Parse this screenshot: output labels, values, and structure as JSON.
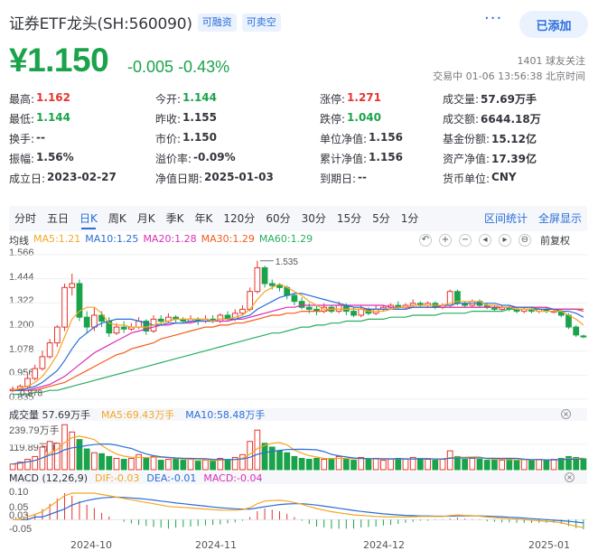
{
  "header": {
    "title": "证券ETF龙头(SH:560090)",
    "tags": [
      "可融资",
      "可卖空"
    ],
    "more_label": "···",
    "add_label": "已添加"
  },
  "quote": {
    "price": "¥1.150",
    "change": "-0.005",
    "change_pct": "-0.43%",
    "followers": "1401 球友关注",
    "trade_time": "交易中 01-06 13:56:38 北京时间",
    "color_up": "#e5352f",
    "color_down": "#1aa34a"
  },
  "stats": [
    [
      {
        "label": "最高:",
        "value": "1.162",
        "tone": "red"
      },
      {
        "label": "今开:",
        "value": "1.144",
        "tone": "green"
      },
      {
        "label": "涨停:",
        "value": "1.271",
        "tone": "red"
      },
      {
        "label": "成交量:",
        "value": "57.69万手",
        "tone": ""
      }
    ],
    [
      {
        "label": "最低:",
        "value": "1.144",
        "tone": "green"
      },
      {
        "label": "昨收:",
        "value": "1.155",
        "tone": ""
      },
      {
        "label": "跌停:",
        "value": "1.040",
        "tone": "green"
      },
      {
        "label": "成交额:",
        "value": "6644.18万",
        "tone": ""
      }
    ],
    [
      {
        "label": "换手:",
        "value": "--",
        "tone": ""
      },
      {
        "label": "市价:",
        "value": "1.150",
        "tone": ""
      },
      {
        "label": "单位净值:",
        "value": "1.156",
        "tone": ""
      },
      {
        "label": "基金份额:",
        "value": "15.12亿",
        "tone": ""
      }
    ],
    [
      {
        "label": "振幅:",
        "value": "1.56%",
        "tone": ""
      },
      {
        "label": "溢价率:",
        "value": "-0.09%",
        "tone": ""
      },
      {
        "label": "累计净值:",
        "value": "1.156",
        "tone": ""
      },
      {
        "label": "资产净值:",
        "value": "17.39亿",
        "tone": ""
      }
    ],
    [
      {
        "label": "成立日:",
        "value": "2023-02-27",
        "tone": ""
      },
      {
        "label": "净值日期:",
        "value": "2025-01-03",
        "tone": ""
      },
      {
        "label": "到期日:",
        "value": "--",
        "tone": ""
      },
      {
        "label": "货币单位:",
        "value": "CNY",
        "tone": ""
      }
    ]
  ],
  "periods": [
    "分时",
    "五日",
    "日K",
    "周K",
    "月K",
    "季K",
    "年K",
    "120分",
    "60分",
    "30分",
    "15分",
    "5分",
    "1分"
  ],
  "active_period": "日K",
  "period_links": [
    "区间统计",
    "全屏显示"
  ],
  "ma_legend": [
    {
      "label": "均线",
      "color": "#33353c"
    },
    {
      "label": "MA5:1.21",
      "color": "#f5a623"
    },
    {
      "label": "MA10:1.25",
      "color": "#2a6dd8"
    },
    {
      "label": "MA20:1.28",
      "color": "#d92fb5"
    },
    {
      "label": "MA30:1.29",
      "color": "#f25c19"
    },
    {
      "label": "MA60:1.29",
      "color": "#27ae60"
    }
  ],
  "tools": [
    "↶",
    "+",
    "−",
    "◂",
    "▸",
    "⊖"
  ],
  "adjust_label": "前复权",
  "price_axis": [
    "1.566",
    "1.444",
    "1.322",
    "1.200",
    "1.078",
    "0.956",
    "0.835"
  ],
  "high_marker": "1.535",
  "low_marker": "0.878",
  "volume": {
    "title": "成交量 57.69万手",
    "ma5": "MA5:69.43万手",
    "ma10": "MA10:58.48万手",
    "axis": [
      "239.79万手",
      "119.89万手"
    ]
  },
  "macd": {
    "title": "MACD (12,26,9)",
    "dif": "DIF:-0.03",
    "dea": "DEA:-0.01",
    "macd": "MACD:-0.04",
    "axis": [
      "0.10",
      "0.05",
      "0.03",
      "-0.05"
    ]
  },
  "x_axis": [
    "2024-10",
    "2024-11",
    "2024-12",
    "2025-01"
  ],
  "chart_data": {
    "type": "candlestick",
    "candles": [
      [
        0.878,
        0.885,
        0.9,
        0.87
      ],
      [
        0.885,
        0.9,
        0.91,
        0.88
      ],
      [
        0.9,
        0.94,
        0.96,
        0.89
      ],
      [
        0.94,
        0.99,
        1.01,
        0.93
      ],
      [
        0.99,
        1.05,
        1.08,
        0.98
      ],
      [
        1.05,
        1.12,
        1.14,
        1.04
      ],
      [
        1.12,
        1.2,
        1.21,
        1.1
      ],
      [
        1.2,
        1.4,
        1.42,
        1.18
      ],
      [
        1.4,
        1.42,
        1.47,
        1.36
      ],
      [
        1.42,
        1.25,
        1.44,
        1.23
      ],
      [
        1.25,
        1.2,
        1.28,
        1.17
      ],
      [
        1.2,
        1.26,
        1.3,
        1.18
      ],
      [
        1.26,
        1.23,
        1.28,
        1.2
      ],
      [
        1.23,
        1.17,
        1.25,
        1.15
      ],
      [
        1.17,
        1.2,
        1.22,
        1.16
      ],
      [
        1.2,
        1.19,
        1.23,
        1.17
      ],
      [
        1.19,
        1.2,
        1.22,
        1.18
      ],
      [
        1.2,
        1.23,
        1.25,
        1.19
      ],
      [
        1.23,
        1.18,
        1.24,
        1.16
      ],
      [
        1.18,
        1.24,
        1.26,
        1.17
      ],
      [
        1.24,
        1.23,
        1.26,
        1.21
      ],
      [
        1.23,
        1.25,
        1.27,
        1.22
      ],
      [
        1.25,
        1.24,
        1.26,
        1.22
      ],
      [
        1.24,
        1.23,
        1.25,
        1.22
      ],
      [
        1.23,
        1.24,
        1.26,
        1.22
      ],
      [
        1.24,
        1.23,
        1.25,
        1.21
      ],
      [
        1.23,
        1.24,
        1.26,
        1.22
      ],
      [
        1.24,
        1.23,
        1.26,
        1.22
      ],
      [
        1.23,
        1.26,
        1.27,
        1.22
      ],
      [
        1.26,
        1.24,
        1.28,
        1.23
      ],
      [
        1.24,
        1.27,
        1.29,
        1.23
      ],
      [
        1.27,
        1.29,
        1.31,
        1.26
      ],
      [
        1.29,
        1.38,
        1.4,
        1.28
      ],
      [
        1.38,
        1.5,
        1.535,
        1.37
      ],
      [
        1.5,
        1.42,
        1.51,
        1.4
      ],
      [
        1.42,
        1.41,
        1.44,
        1.39
      ],
      [
        1.41,
        1.4,
        1.42,
        1.38
      ],
      [
        1.4,
        1.36,
        1.41,
        1.34
      ],
      [
        1.36,
        1.33,
        1.37,
        1.31
      ],
      [
        1.33,
        1.3,
        1.35,
        1.29
      ],
      [
        1.3,
        1.29,
        1.32,
        1.27
      ],
      [
        1.29,
        1.28,
        1.31,
        1.26
      ],
      [
        1.28,
        1.3,
        1.32,
        1.27
      ],
      [
        1.3,
        1.28,
        1.31,
        1.27
      ],
      [
        1.28,
        1.31,
        1.33,
        1.27
      ],
      [
        1.31,
        1.28,
        1.32,
        1.26
      ],
      [
        1.28,
        1.26,
        1.3,
        1.25
      ],
      [
        1.26,
        1.29,
        1.31,
        1.25
      ],
      [
        1.29,
        1.27,
        1.3,
        1.26
      ],
      [
        1.27,
        1.29,
        1.31,
        1.26
      ],
      [
        1.29,
        1.3,
        1.31,
        1.28
      ],
      [
        1.3,
        1.31,
        1.32,
        1.29
      ],
      [
        1.31,
        1.3,
        1.33,
        1.29
      ],
      [
        1.3,
        1.31,
        1.32,
        1.29
      ],
      [
        1.31,
        1.32,
        1.34,
        1.3
      ],
      [
        1.32,
        1.31,
        1.33,
        1.3
      ],
      [
        1.31,
        1.32,
        1.33,
        1.3
      ],
      [
        1.32,
        1.3,
        1.33,
        1.29
      ],
      [
        1.3,
        1.31,
        1.32,
        1.29
      ],
      [
        1.31,
        1.38,
        1.39,
        1.3
      ],
      [
        1.38,
        1.32,
        1.39,
        1.31
      ],
      [
        1.32,
        1.31,
        1.33,
        1.3
      ],
      [
        1.31,
        1.33,
        1.34,
        1.3
      ],
      [
        1.33,
        1.31,
        1.34,
        1.3
      ],
      [
        1.31,
        1.3,
        1.32,
        1.29
      ],
      [
        1.3,
        1.29,
        1.31,
        1.28
      ],
      [
        1.29,
        1.3,
        1.31,
        1.28
      ],
      [
        1.3,
        1.29,
        1.31,
        1.28
      ],
      [
        1.29,
        1.28,
        1.3,
        1.27
      ],
      [
        1.28,
        1.29,
        1.3,
        1.27
      ],
      [
        1.29,
        1.28,
        1.3,
        1.27
      ],
      [
        1.28,
        1.29,
        1.3,
        1.27
      ],
      [
        1.29,
        1.28,
        1.3,
        1.27
      ],
      [
        1.28,
        1.28,
        1.29,
        1.27
      ],
      [
        1.28,
        1.26,
        1.29,
        1.25
      ],
      [
        1.26,
        1.2,
        1.27,
        1.19
      ],
      [
        1.2,
        1.16,
        1.21,
        1.15
      ],
      [
        1.155,
        1.15,
        1.162,
        1.144
      ]
    ],
    "ma5": [
      0.88,
      0.89,
      0.9,
      0.92,
      0.95,
      1.0,
      1.06,
      1.15,
      1.24,
      1.28,
      1.3,
      1.3,
      1.27,
      1.22,
      1.21,
      1.21,
      1.2,
      1.2,
      1.2,
      1.21,
      1.22,
      1.23,
      1.24,
      1.24,
      1.24,
      1.24,
      1.24,
      1.23,
      1.24,
      1.24,
      1.25,
      1.26,
      1.29,
      1.34,
      1.38,
      1.4,
      1.42,
      1.4,
      1.38,
      1.36,
      1.33,
      1.31,
      1.29,
      1.29,
      1.29,
      1.29,
      1.29,
      1.29,
      1.28,
      1.28,
      1.28,
      1.29,
      1.3,
      1.3,
      1.31,
      1.31,
      1.31,
      1.31,
      1.31,
      1.32,
      1.33,
      1.33,
      1.33,
      1.33,
      1.31,
      1.31,
      1.3,
      1.3,
      1.29,
      1.29,
      1.29,
      1.28,
      1.28,
      1.28,
      1.28,
      1.26,
      1.24,
      1.21
    ],
    "ma10": [
      0.88,
      0.88,
      0.89,
      0.9,
      0.92,
      0.95,
      0.98,
      1.03,
      1.09,
      1.14,
      1.17,
      1.2,
      1.22,
      1.23,
      1.24,
      1.24,
      1.24,
      1.23,
      1.22,
      1.21,
      1.21,
      1.22,
      1.22,
      1.22,
      1.23,
      1.23,
      1.23,
      1.23,
      1.24,
      1.24,
      1.24,
      1.25,
      1.26,
      1.29,
      1.31,
      1.33,
      1.35,
      1.36,
      1.37,
      1.37,
      1.36,
      1.35,
      1.34,
      1.33,
      1.32,
      1.31,
      1.3,
      1.3,
      1.29,
      1.29,
      1.29,
      1.29,
      1.29,
      1.29,
      1.3,
      1.3,
      1.3,
      1.3,
      1.31,
      1.31,
      1.32,
      1.32,
      1.32,
      1.32,
      1.32,
      1.32,
      1.31,
      1.31,
      1.3,
      1.3,
      1.3,
      1.29,
      1.29,
      1.29,
      1.28,
      1.28,
      1.27,
      1.25
    ],
    "ma20": [
      0.88,
      0.88,
      0.88,
      0.89,
      0.9,
      0.91,
      0.93,
      0.95,
      0.98,
      1.01,
      1.04,
      1.07,
      1.09,
      1.11,
      1.13,
      1.15,
      1.17,
      1.18,
      1.19,
      1.2,
      1.21,
      1.21,
      1.22,
      1.22,
      1.22,
      1.23,
      1.23,
      1.23,
      1.23,
      1.23,
      1.24,
      1.24,
      1.25,
      1.26,
      1.27,
      1.28,
      1.29,
      1.3,
      1.3,
      1.31,
      1.31,
      1.31,
      1.31,
      1.31,
      1.31,
      1.31,
      1.31,
      1.31,
      1.31,
      1.31,
      1.31,
      1.3,
      1.3,
      1.3,
      1.3,
      1.3,
      1.3,
      1.3,
      1.3,
      1.3,
      1.3,
      1.3,
      1.3,
      1.3,
      1.3,
      1.3,
      1.3,
      1.3,
      1.3,
      1.3,
      1.3,
      1.3,
      1.3,
      1.29,
      1.29,
      1.29,
      1.29,
      1.28
    ],
    "ma30": [
      0.88,
      0.88,
      0.88,
      0.88,
      0.89,
      0.9,
      0.91,
      0.92,
      0.94,
      0.96,
      0.98,
      1.0,
      1.02,
      1.04,
      1.06,
      1.07,
      1.09,
      1.1,
      1.11,
      1.12,
      1.14,
      1.15,
      1.16,
      1.17,
      1.18,
      1.19,
      1.2,
      1.2,
      1.21,
      1.21,
      1.22,
      1.22,
      1.23,
      1.24,
      1.25,
      1.26,
      1.26,
      1.27,
      1.27,
      1.28,
      1.28,
      1.28,
      1.28,
      1.29,
      1.29,
      1.29,
      1.29,
      1.29,
      1.29,
      1.29,
      1.29,
      1.29,
      1.29,
      1.29,
      1.3,
      1.3,
      1.3,
      1.3,
      1.3,
      1.3,
      1.3,
      1.3,
      1.3,
      1.3,
      1.3,
      1.3,
      1.3,
      1.3,
      1.3,
      1.3,
      1.3,
      1.3,
      1.3,
      1.29,
      1.29,
      1.29,
      1.29,
      1.29
    ],
    "ma60": [
      0.86,
      0.86,
      0.86,
      0.87,
      0.87,
      0.88,
      0.88,
      0.89,
      0.9,
      0.91,
      0.92,
      0.93,
      0.94,
      0.95,
      0.96,
      0.97,
      0.98,
      0.99,
      1.0,
      1.01,
      1.02,
      1.03,
      1.04,
      1.05,
      1.06,
      1.07,
      1.08,
      1.09,
      1.1,
      1.11,
      1.12,
      1.13,
      1.14,
      1.15,
      1.16,
      1.17,
      1.17,
      1.18,
      1.19,
      1.2,
      1.2,
      1.21,
      1.21,
      1.22,
      1.22,
      1.23,
      1.23,
      1.23,
      1.24,
      1.24,
      1.24,
      1.25,
      1.25,
      1.25,
      1.26,
      1.26,
      1.26,
      1.26,
      1.27,
      1.27,
      1.27,
      1.27,
      1.28,
      1.28,
      1.28,
      1.28,
      1.28,
      1.29,
      1.29,
      1.29,
      1.29,
      1.29,
      1.29,
      1.29,
      1.29,
      1.29,
      1.29,
      1.29
    ],
    "volumes": [
      30,
      40,
      55,
      70,
      120,
      150,
      140,
      239,
      200,
      160,
      110,
      90,
      85,
      70,
      60,
      55,
      60,
      80,
      65,
      70,
      50,
      55,
      60,
      50,
      55,
      45,
      50,
      45,
      60,
      55,
      65,
      80,
      150,
      210,
      140,
      120,
      100,
      90,
      70,
      60,
      55,
      60,
      55,
      60,
      70,
      55,
      50,
      65,
      55,
      60,
      50,
      55,
      60,
      55,
      65,
      60,
      55,
      50,
      55,
      100,
      70,
      55,
      60,
      55,
      50,
      55,
      50,
      55,
      50,
      55,
      50,
      55,
      50,
      55,
      60,
      70,
      65,
      58
    ],
    "dif": [
      0.0,
      0.0,
      0.01,
      0.02,
      0.03,
      0.05,
      0.07,
      0.09,
      0.1,
      0.1,
      0.1,
      0.1,
      0.095,
      0.09,
      0.085,
      0.08,
      0.075,
      0.07,
      0.065,
      0.06,
      0.055,
      0.05,
      0.048,
      0.046,
      0.044,
      0.042,
      0.04,
      0.038,
      0.036,
      0.036,
      0.036,
      0.038,
      0.045,
      0.06,
      0.07,
      0.072,
      0.073,
      0.07,
      0.065,
      0.058,
      0.05,
      0.042,
      0.036,
      0.03,
      0.026,
      0.022,
      0.018,
      0.016,
      0.014,
      0.012,
      0.011,
      0.01,
      0.01,
      0.01,
      0.011,
      0.012,
      0.012,
      0.012,
      0.012,
      0.015,
      0.018,
      0.016,
      0.015,
      0.013,
      0.01,
      0.008,
      0.006,
      0.004,
      0.002,
      0.0,
      -0.002,
      -0.004,
      -0.006,
      -0.008,
      -0.012,
      -0.018,
      -0.025,
      -0.03
    ],
    "dea": [
      0.0,
      0.0,
      0.0,
      0.01,
      0.01,
      0.02,
      0.03,
      0.04,
      0.055,
      0.065,
      0.072,
      0.078,
      0.082,
      0.084,
      0.085,
      0.084,
      0.082,
      0.08,
      0.077,
      0.074,
      0.07,
      0.067,
      0.063,
      0.06,
      0.057,
      0.054,
      0.051,
      0.048,
      0.045,
      0.043,
      0.041,
      0.04,
      0.04,
      0.044,
      0.049,
      0.053,
      0.057,
      0.059,
      0.06,
      0.06,
      0.058,
      0.055,
      0.051,
      0.047,
      0.043,
      0.039,
      0.035,
      0.031,
      0.028,
      0.025,
      0.022,
      0.02,
      0.018,
      0.016,
      0.015,
      0.014,
      0.014,
      0.013,
      0.013,
      0.013,
      0.014,
      0.014,
      0.014,
      0.014,
      0.013,
      0.012,
      0.011,
      0.009,
      0.008,
      0.006,
      0.004,
      0.002,
      0.0,
      -0.002,
      -0.004,
      -0.006,
      -0.009,
      -0.012
    ]
  }
}
